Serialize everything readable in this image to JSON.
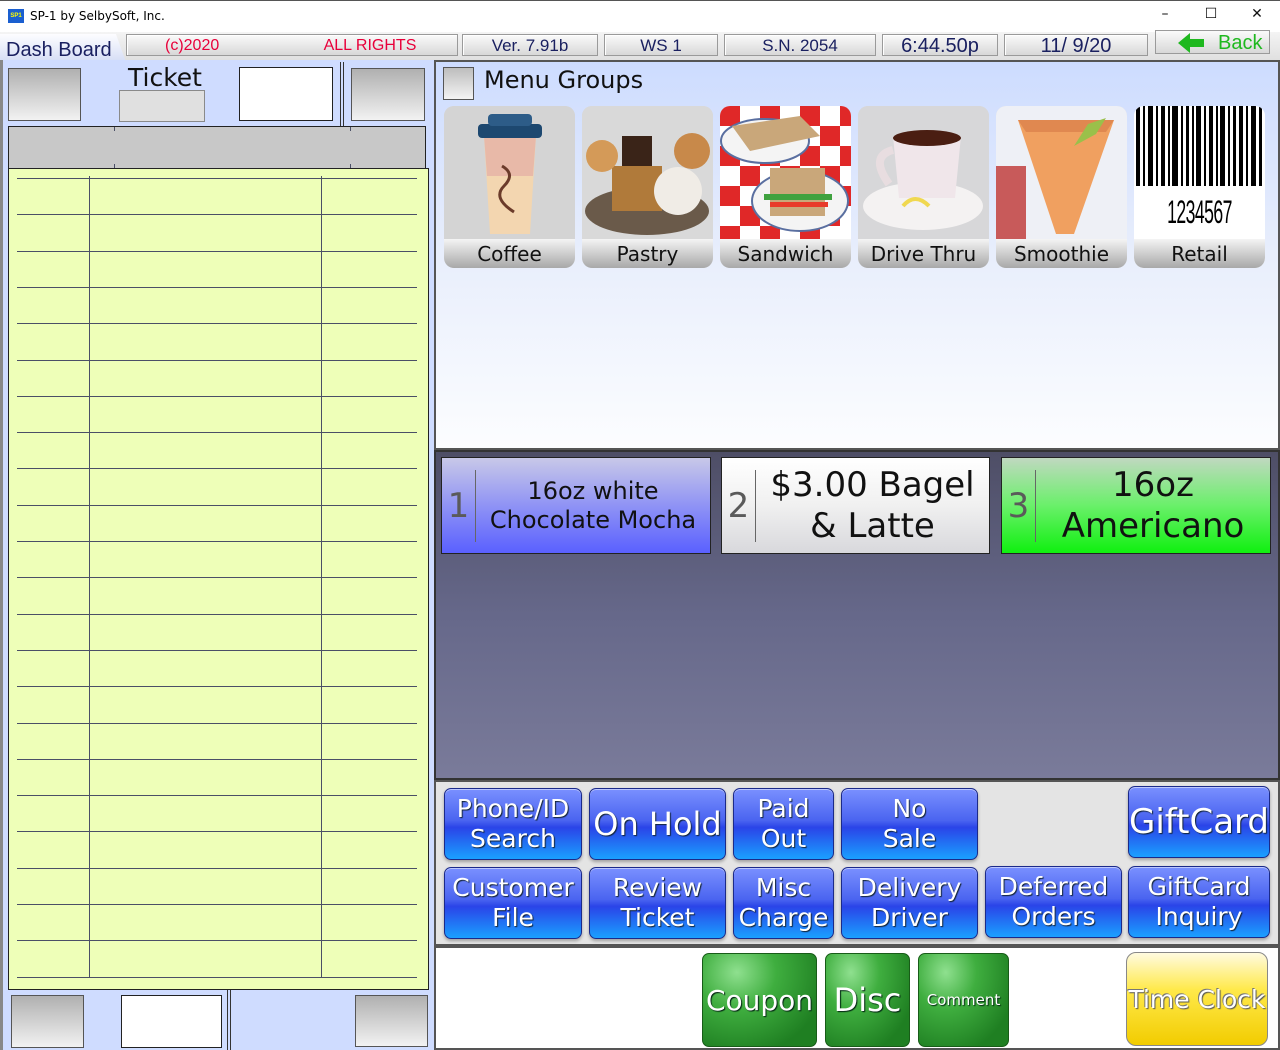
{
  "window": {
    "title": "SP-1 by SelbySoft, Inc.",
    "app_icon_text": "SP1",
    "minimize_glyph": "–",
    "maximize_glyph": "☐",
    "close_glyph": "✕"
  },
  "status_bar": {
    "tab_label": "Dash Board",
    "copyright": "(c)2020",
    "rights": "ALL RIGHTS RESERVED",
    "version": "Ver. 7.91b",
    "workstation": "WS  1",
    "serial": "S.N. 2054",
    "time": "6:44.50p",
    "date": "11/ 9/20",
    "back_label": "Back",
    "back_icon": "left-arrow-icon"
  },
  "ticket": {
    "title": "Ticket",
    "number": "",
    "rows": 22
  },
  "menu_groups": {
    "title": "Menu Groups",
    "items": [
      {
        "label": "Coffee",
        "icon": "coffee-cup-image"
      },
      {
        "label": "Pastry",
        "icon": "pastry-image"
      },
      {
        "label": "Sandwich",
        "icon": "sandwich-image"
      },
      {
        "label": "Drive Thru",
        "icon": "teacup-image"
      },
      {
        "label": "Smoothie",
        "icon": "smoothie-image"
      },
      {
        "label": "Retail",
        "icon": "barcode-image",
        "barcode_text": "1234567"
      }
    ]
  },
  "open_orders": [
    {
      "number": "1",
      "line1": "16oz white",
      "line2": "Chocolate Mocha",
      "color": "#6a70ff"
    },
    {
      "number": "2",
      "line1": "$3.00 Bagel",
      "line2": "& Latte",
      "color": "#f2f2f2"
    },
    {
      "number": "3",
      "line1": "16oz",
      "line2": "Americano",
      "color": "#1ef01e"
    }
  ],
  "function_buttons": {
    "row1": [
      {
        "line1": "Phone/ID",
        "line2": "Search"
      },
      {
        "line1": "On Hold",
        "line2": ""
      },
      {
        "line1": "Paid",
        "line2": "Out"
      },
      {
        "line1": "No",
        "line2": "Sale"
      },
      {
        "line1": "GiftCard",
        "line2": ""
      }
    ],
    "row2": [
      {
        "line1": "Customer",
        "line2": "File"
      },
      {
        "line1": "Review",
        "line2": "Ticket"
      },
      {
        "line1": "Misc",
        "line2": "Charge"
      },
      {
        "line1": "Delivery",
        "line2": "Driver"
      },
      {
        "line1": "Deferred",
        "line2": "Orders"
      },
      {
        "line1": "GiftCard",
        "line2": "Inquiry"
      }
    ]
  },
  "actions": {
    "coupon": "Coupon",
    "disc": "Disc",
    "comment": "Comment",
    "time_clock": "Time Clock"
  },
  "colors": {
    "ticket_paper": "#eeffb8",
    "panel_blue": "#cfdcff",
    "button_blue": "#2a44e8",
    "button_green": "#1f7f22",
    "button_yellow": "#ffe94a",
    "status_red": "#e8003a",
    "status_navy": "#1a2060",
    "back_green": "#1fb81f"
  }
}
